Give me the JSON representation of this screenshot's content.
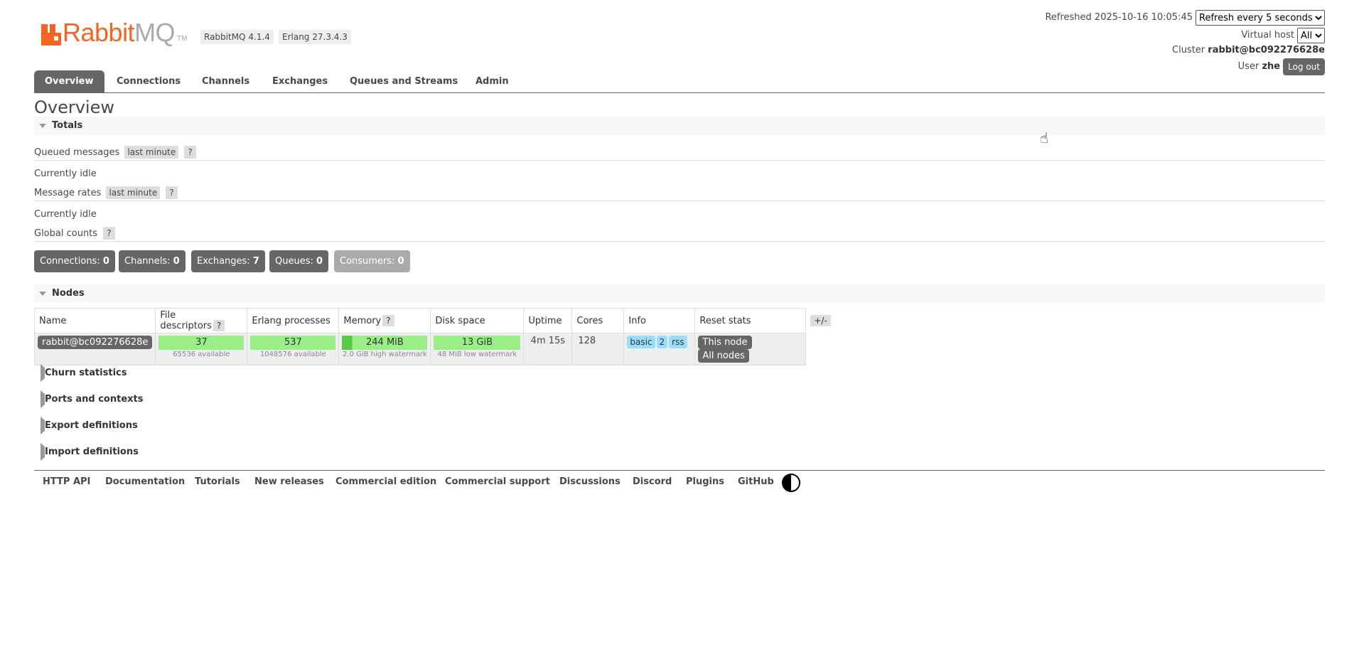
{
  "brand": {
    "rabbit": "Rabbit",
    "mq": "MQ",
    "tm": "TM"
  },
  "versions": {
    "rabbitmq": "RabbitMQ 4.1.4",
    "erlang": "Erlang 27.3.4.3"
  },
  "header": {
    "refreshed": "Refreshed 2025-10-16 10:05:45",
    "refresh_option": "Refresh every 5 seconds",
    "vhost_label": "Virtual host",
    "vhost_value": "All",
    "cluster_label": "Cluster",
    "cluster_value": "rabbit@bc092276628e",
    "user_label": "User",
    "user_value": "zhe",
    "logout": "Log out"
  },
  "tabs": [
    "Overview",
    "Connections",
    "Channels",
    "Exchanges",
    "Queues and Streams",
    "Admin"
  ],
  "page_title": "Overview",
  "totals": {
    "title": "Totals",
    "queued_label": "Queued messages",
    "queued_range": "last minute",
    "help": "?",
    "idle1": "Currently idle",
    "rates_label": "Message rates",
    "rates_range": "last minute",
    "idle2": "Currently idle",
    "global_label": "Global counts",
    "counts": [
      {
        "label": "Connections:",
        "value": "0"
      },
      {
        "label": "Channels:",
        "value": "0"
      },
      {
        "label": "Exchanges:",
        "value": "7"
      },
      {
        "label": "Queues:",
        "value": "0"
      },
      {
        "label": "Consumers:",
        "value": "0"
      }
    ]
  },
  "nodes": {
    "title": "Nodes",
    "headers": [
      "Name",
      "File descriptors",
      "Erlang processes",
      "Memory",
      "Disk space",
      "Uptime",
      "Cores",
      "Info",
      "Reset stats"
    ],
    "plusminus": "+/-",
    "row": {
      "name": "rabbit@bc092276628e",
      "fd": "37",
      "fd_sub": "65536 available",
      "proc": "537",
      "proc_sub": "1048576 available",
      "mem": "244 MiB",
      "mem_sub": "2.0 GiB high watermark",
      "disk": "13 GiB",
      "disk_sub": "48 MiB low watermark",
      "uptime": "4m 15s",
      "cores": "128",
      "info": [
        "basic",
        "2",
        "rss"
      ],
      "reset_this": "This node",
      "reset_all": "All nodes"
    }
  },
  "collapsed_sections": [
    "Churn statistics",
    "Ports and contexts",
    "Export definitions",
    "Import definitions"
  ],
  "footer": [
    "HTTP API",
    "Documentation",
    "Tutorials",
    "New releases",
    "Commercial edition",
    "Commercial support",
    "Discussions",
    "Discord",
    "Plugins",
    "GitHub"
  ]
}
